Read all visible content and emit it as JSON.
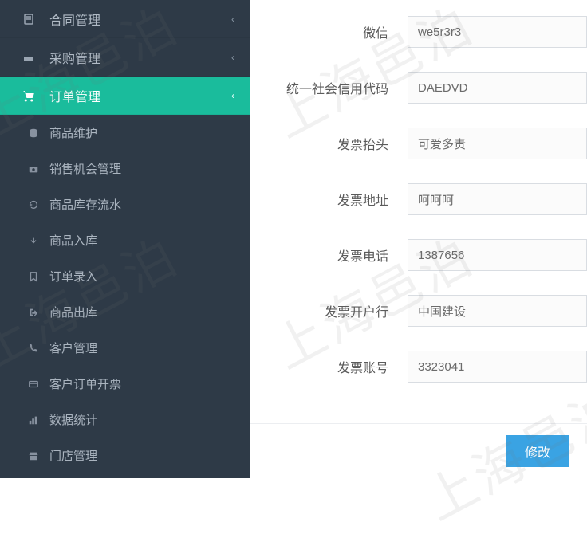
{
  "watermark_text": "上海邑泊",
  "sidebar": {
    "top": [
      {
        "label": "合同管理",
        "icon": "file"
      },
      {
        "label": "采购管理",
        "icon": "purchase"
      }
    ],
    "active": {
      "label": "订单管理",
      "icon": "cart"
    },
    "subs": [
      {
        "label": "商品维护",
        "icon": "db"
      },
      {
        "label": "销售机会管理",
        "icon": "camera"
      },
      {
        "label": "商品库存流水",
        "icon": "history"
      },
      {
        "label": "商品入库",
        "icon": "in"
      },
      {
        "label": "订单录入",
        "icon": "bookmark"
      },
      {
        "label": "商品出库",
        "icon": "out"
      },
      {
        "label": "客户管理",
        "icon": "phone"
      },
      {
        "label": "客户订单开票",
        "icon": "invoice"
      },
      {
        "label": "数据统计",
        "icon": "chart"
      },
      {
        "label": "门店管理",
        "icon": "store"
      }
    ]
  },
  "form": {
    "rows": [
      {
        "label": "微信",
        "value": "we5r3r3"
      },
      {
        "label": "统一社会信用代码",
        "value": "DAEDVD"
      },
      {
        "label": "发票抬头",
        "value": "可爱多责"
      },
      {
        "label": "发票地址",
        "value": "呵呵呵"
      },
      {
        "label": "发票电话",
        "value": "1387656"
      },
      {
        "label": "发票开户行",
        "value": "中国建设"
      },
      {
        "label": "发票账号",
        "value": "3323041"
      }
    ]
  },
  "footer": {
    "modify": "修改"
  }
}
